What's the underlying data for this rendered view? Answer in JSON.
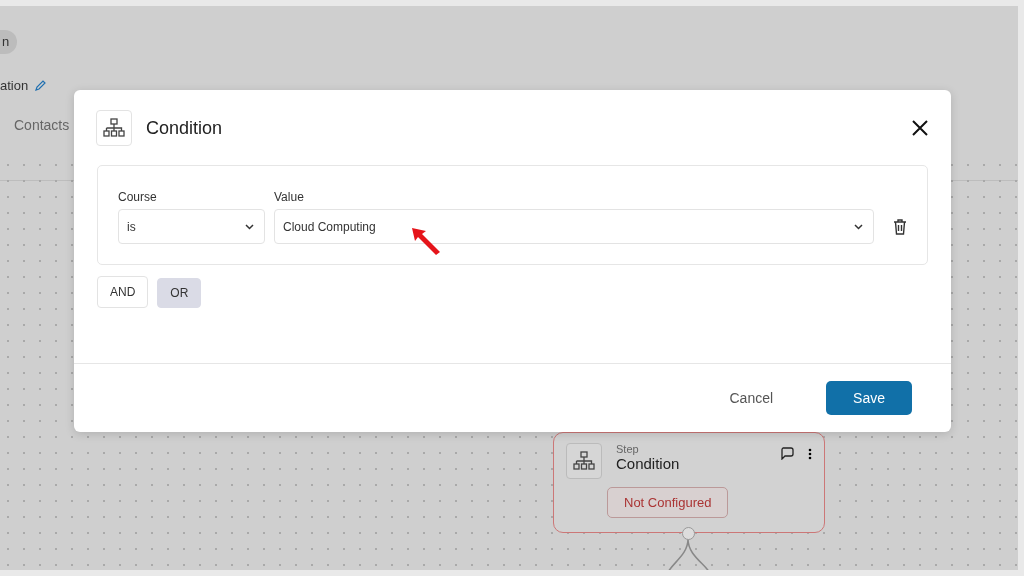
{
  "background": {
    "badge": "n",
    "name": "ation",
    "tab": "Contacts",
    "node": {
      "caption": "Step",
      "title": "Condition",
      "status": "Not Configured"
    }
  },
  "dialog": {
    "title": "Condition",
    "rule": {
      "field_label": "Course",
      "operator": "is",
      "value_label": "Value",
      "value": "Cloud Computing"
    },
    "connectors": [
      {
        "label": "AND",
        "selected": false
      },
      {
        "label": "OR",
        "selected": true
      }
    ],
    "buttons": [
      {
        "label": "Cancel",
        "kind": "text"
      },
      {
        "label": "Save",
        "kind": "primary"
      }
    ]
  }
}
